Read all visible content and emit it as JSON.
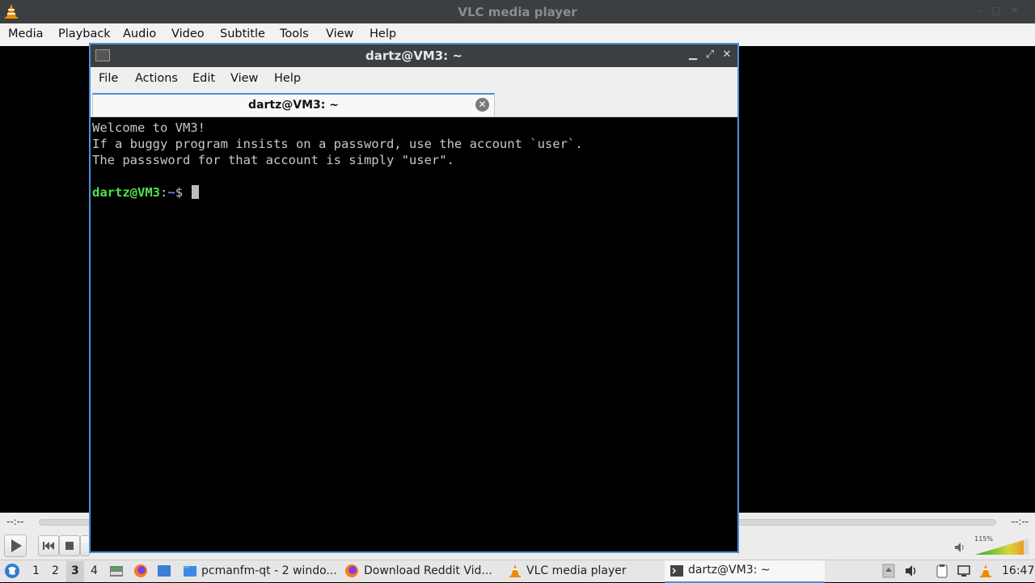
{
  "vlc": {
    "title": "VLC media player",
    "menu": [
      "Media",
      "Playback",
      "Audio",
      "Video",
      "Subtitle",
      "Tools",
      "View",
      "Help"
    ],
    "time_elapsed": "--:--",
    "time_total": "--:--",
    "volume_percent": "115%"
  },
  "terminal": {
    "title": "dartz@VM3: ~",
    "menu": [
      "File",
      "Actions",
      "Edit",
      "View",
      "Help"
    ],
    "tab_label": "dartz@VM3: ~",
    "lines": [
      "Welcome to VM3!",
      "If a buggy program insists on a password, use the account `user`.",
      "The passsword for that account is simply \"user\"."
    ],
    "prompt_user": "dartz@VM3",
    "prompt_sep": ":",
    "prompt_path": "~",
    "prompt_symbol": "$ "
  },
  "taskbar": {
    "workspaces": [
      "1",
      "2",
      "3",
      "4"
    ],
    "active_workspace": "3",
    "tasks": [
      {
        "label": "pcmanfm-qt - 2 windo...",
        "icon": "folder-icon"
      },
      {
        "label": "Download Reddit Vid...",
        "icon": "firefox-icon"
      },
      {
        "label": "VLC media player",
        "icon": "vlc-cone-icon"
      },
      {
        "label": "dartz@VM3: ~",
        "icon": "terminal-icon"
      }
    ],
    "clock": "16:47"
  },
  "colors": {
    "accent": "#4a90d9",
    "vlc_orange": "#f08a00",
    "prompt_green": "#4ee34e",
    "prompt_blue": "#5b8ef0"
  }
}
